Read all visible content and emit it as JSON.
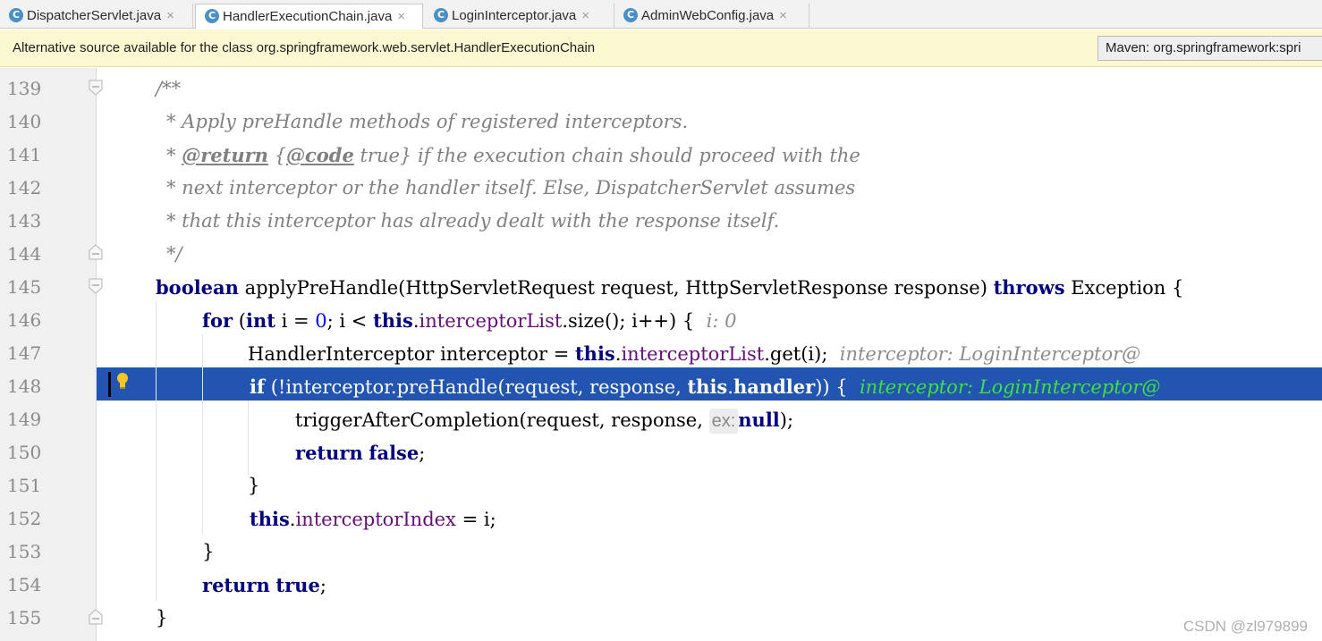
{
  "tabs": [
    {
      "label": "DispatcherServlet.java",
      "icon": "c-class-icon",
      "active": false
    },
    {
      "label": "HandlerExecutionChain.java",
      "icon": "c-class-icon",
      "active": true
    },
    {
      "label": "LoginInterceptor.java",
      "icon": "c-class-icon",
      "active": false
    },
    {
      "label": "AdminWebConfig.java",
      "icon": "c-class-icon",
      "active": false
    }
  ],
  "tab_icon_letter": "C",
  "tab_close_glyph": "×",
  "notice": {
    "text": "Alternative source available for the class org.springframework.web.servlet.HandlerExecutionChain",
    "button": "Maven: org.springframework:spri"
  },
  "line_numbers": [
    "139",
    "140",
    "141",
    "142",
    "143",
    "144",
    "145",
    "146",
    "147",
    "148",
    "149",
    "150",
    "151",
    "152",
    "153",
    "154",
    "155"
  ],
  "code": {
    "l139": "/**",
    "l140": "* Apply preHandle methods of registered interceptors.",
    "l141_star": "* ",
    "l141_return": "@return",
    "l141_sp": " {",
    "l141_code": "@code",
    "l141_rest": " true} if the execution chain should proceed with the",
    "l142": "* next interceptor or the handler itself. Else, DispatcherServlet assumes",
    "l143": "* that this interceptor has already dealt with the response itself.",
    "l144": "*/",
    "l145_kw": "boolean",
    "l145_mid": " applyPreHandle(HttpServletRequest request, HttpServletResponse response) ",
    "l145_throws": "throws",
    "l145_end": " Exception {",
    "l146_for": "for",
    "l146_a": " (",
    "l146_int": "int",
    "l146_b": " i = ",
    "l146_zero": "0",
    "l146_c": "; i < ",
    "l146_this": "this",
    "l146_dot": ".",
    "l146_field": "interceptorList",
    "l146_d": ".size(); i++) {  ",
    "l146_hint": "i: 0",
    "l147_a": "HandlerInterceptor interceptor = ",
    "l147_this": "this",
    "l147_dot": ".",
    "l147_field": "interceptorList",
    "l147_b": ".get(i);  ",
    "l147_hint": "interceptor: LoginInterceptor@",
    "l148_if": "if",
    "l148_a": " (!interceptor.preHandle(request, response, ",
    "l148_this": "this",
    "l148_dot": ".",
    "l148_field": "handler",
    "l148_b": ")) {  ",
    "l148_hint": "interceptor: LoginInterceptor@",
    "l149_a": "triggerAfterCompletion(request, response, ",
    "l149_param": "ex:",
    "l149_null": "null",
    "l149_b": ");",
    "l150_return": "return",
    "l150_false": "false",
    "l150_semi": ";",
    "l151": "}",
    "l152_this": "this",
    "l152_dot": ".",
    "l152_field": "interceptorIndex",
    "l152_b": " = i;",
    "l153": "}",
    "l154_return": "return",
    "l154_true": "true",
    "l154_semi": ";",
    "l155": "}"
  },
  "watermark": "CSDN @zl979899",
  "colors": {
    "keyword": "#000080",
    "field": "#660e7a",
    "number": "#0000ff",
    "comment": "#808080",
    "execution_line": "#2255b2",
    "inline_hint_on_exec_line": "#3fe03f",
    "notice_bg": "#fcf8d2"
  }
}
